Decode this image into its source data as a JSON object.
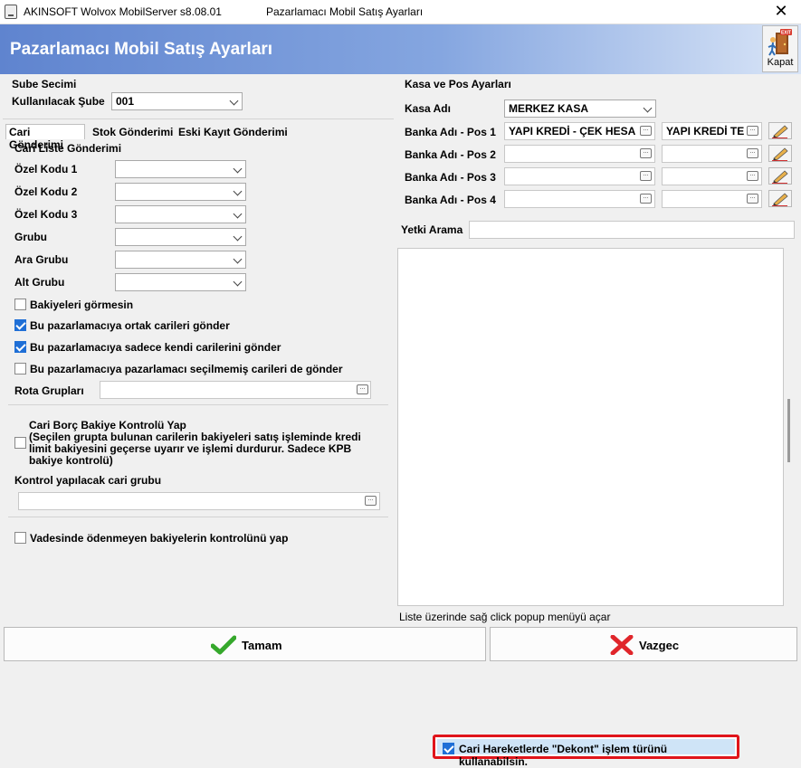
{
  "window": {
    "title": "AKINSOFT Wolvox MobilServer s8.08.01",
    "subtitle": "Pazarlamacı Mobil Satış Ayarları",
    "close_symbol": "✕"
  },
  "header": {
    "title": "Pazarlamacı Mobil Satış Ayarları",
    "close_button": {
      "label": "Kapat",
      "icon": "exit-door-icon",
      "badge": "EXIT"
    }
  },
  "branch": {
    "group_title": "Sube Secimi",
    "label": "Kullanılacak Şube",
    "value": "001"
  },
  "tabs": [
    {
      "label": "Cari Gönderimi",
      "active": true
    },
    {
      "label": "Stok Gönderimi",
      "active": false
    },
    {
      "label": "Eski Kayıt Gönderimi",
      "active": false
    }
  ],
  "cari_list": {
    "group_title": "Cari Liste Gönderimi",
    "fields": [
      {
        "label": "Özel Kodu 1",
        "value": ""
      },
      {
        "label": "Özel Kodu 2",
        "value": ""
      },
      {
        "label": "Özel Kodu 3",
        "value": ""
      },
      {
        "label": "Grubu",
        "value": ""
      },
      {
        "label": "Ara Grubu",
        "value": ""
      },
      {
        "label": "Alt Grubu",
        "value": ""
      }
    ],
    "checkboxes": [
      {
        "label": "Bakiyeleri görmesin",
        "checked": false
      },
      {
        "label": "Bu pazarlamacıya ortak carileri gönder",
        "checked": true
      },
      {
        "label": "Bu pazarlamacıya sadece kendi carilerini gönder",
        "checked": true
      },
      {
        "label": "Bu pazarlamacıya pazarlamacı seçilmemiş carileri de gönder",
        "checked": false
      }
    ],
    "rota_label": "Rota Grupları",
    "rota_value": ""
  },
  "balance_control": {
    "checked": false,
    "title": "Cari Borç Bakiye Kontrolü Yap",
    "description_lines": [
      "(Seçilen grupta bulunan carilerin bakiyeleri satış işleminde kredi",
      "limit bakiyesini geçerse uyarır ve işlemi durdurur. Sadece KPB",
      "bakiye kontrolü)"
    ],
    "group_label": "Kontrol yapılacak cari grubu",
    "group_value": ""
  },
  "overdue_check": {
    "label": "Vadesinde ödenmeyen bakiyelerin kontrolünü yap",
    "checked": false
  },
  "kasa_pos": {
    "group_title": "Kasa ve Pos Ayarları",
    "kasa_label": "Kasa Adı",
    "kasa_value": "MERKEZ KASA",
    "banks": [
      {
        "label": "Banka Adı - Pos 1",
        "value1": "YAPI KREDİ - ÇEK HESA",
        "value2": "YAPI KREDİ TE"
      },
      {
        "label": "Banka Adı - Pos 2",
        "value1": "",
        "value2": ""
      },
      {
        "label": "Banka Adı - Pos 3",
        "value1": "",
        "value2": ""
      },
      {
        "label": "Banka Adı - Pos 4",
        "value1": "",
        "value2": ""
      }
    ]
  },
  "yetki": {
    "label": "Yetki Arama",
    "value": ""
  },
  "dekont": {
    "label": "Cari Hareketlerde \"Dekont\" işlem türünü kullanabilsin.",
    "checked": true
  },
  "footer_hint": "Liste üzerinde sağ click popup menüyü açar",
  "buttons": {
    "ok": {
      "label": "Tamam",
      "icon": "green-check-icon"
    },
    "cancel": {
      "label": "Vazgec",
      "icon": "red-x-icon"
    }
  }
}
